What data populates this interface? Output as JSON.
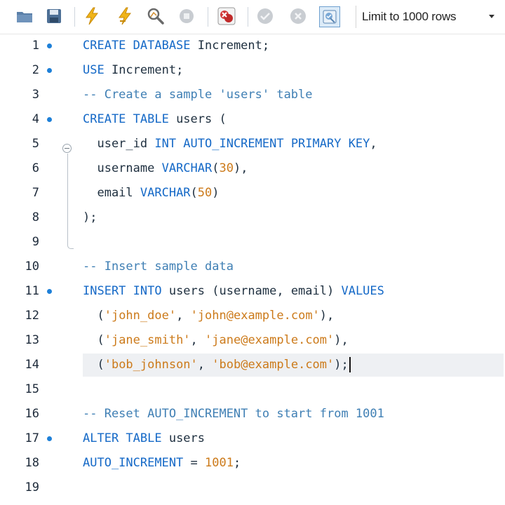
{
  "toolbar": {
    "icons": [
      "open-folder-icon",
      "save-icon",
      "execute-icon",
      "execute-statement-icon",
      "explain-icon",
      "stop-icon",
      "error-toggle-icon",
      "commit-icon",
      "rollback-icon",
      "autocommit-icon"
    ],
    "limit_label": "Limit to 1000 rows"
  },
  "editor": {
    "lines": [
      {
        "num": "1",
        "marker": true,
        "tokens": [
          {
            "t": "CREATE DATABASE",
            "k": "kw"
          },
          {
            "t": " Increment;",
            "k": "plain"
          }
        ]
      },
      {
        "num": "2",
        "marker": true,
        "tokens": [
          {
            "t": "USE",
            "k": "kw"
          },
          {
            "t": " Increment;",
            "k": "plain"
          }
        ]
      },
      {
        "num": "3",
        "marker": false,
        "tokens": [
          {
            "t": "-- Create a sample 'users' table",
            "k": "cm"
          }
        ]
      },
      {
        "num": "4",
        "marker": true,
        "tokens": [
          {
            "t": "CREATE TABLE",
            "k": "kw"
          },
          {
            "t": " users (",
            "k": "plain"
          }
        ]
      },
      {
        "num": "5",
        "marker": false,
        "tokens": [
          {
            "t": "  user_id ",
            "k": "plain"
          },
          {
            "t": "INT AUTO_INCREMENT PRIMARY KEY",
            "k": "kw"
          },
          {
            "t": ",",
            "k": "plain"
          }
        ]
      },
      {
        "num": "6",
        "marker": false,
        "tokens": [
          {
            "t": "  username ",
            "k": "plain"
          },
          {
            "t": "VARCHAR",
            "k": "kw"
          },
          {
            "t": "(",
            "k": "plain"
          },
          {
            "t": "30",
            "k": "num"
          },
          {
            "t": "),",
            "k": "plain"
          }
        ]
      },
      {
        "num": "7",
        "marker": false,
        "tokens": [
          {
            "t": "  email ",
            "k": "plain"
          },
          {
            "t": "VARCHAR",
            "k": "kw"
          },
          {
            "t": "(",
            "k": "plain"
          },
          {
            "t": "50",
            "k": "num"
          },
          {
            "t": ")",
            "k": "plain"
          }
        ]
      },
      {
        "num": "8",
        "marker": false,
        "tokens": [
          {
            "t": ");",
            "k": "plain"
          }
        ]
      },
      {
        "num": "9",
        "marker": false,
        "tokens": []
      },
      {
        "num": "10",
        "marker": false,
        "tokens": [
          {
            "t": "-- Insert sample data",
            "k": "cm"
          }
        ]
      },
      {
        "num": "11",
        "marker": true,
        "tokens": [
          {
            "t": "INSERT INTO",
            "k": "kw"
          },
          {
            "t": " users (username, email) ",
            "k": "plain"
          },
          {
            "t": "VALUES",
            "k": "kw"
          }
        ]
      },
      {
        "num": "12",
        "marker": false,
        "tokens": [
          {
            "t": "  (",
            "k": "plain"
          },
          {
            "t": "'john_doe'",
            "k": "str"
          },
          {
            "t": ", ",
            "k": "plain"
          },
          {
            "t": "'john@example.com'",
            "k": "str"
          },
          {
            "t": "),",
            "k": "plain"
          }
        ]
      },
      {
        "num": "13",
        "marker": false,
        "tokens": [
          {
            "t": "  (",
            "k": "plain"
          },
          {
            "t": "'jane_smith'",
            "k": "str"
          },
          {
            "t": ", ",
            "k": "plain"
          },
          {
            "t": "'jane@example.com'",
            "k": "str"
          },
          {
            "t": "),",
            "k": "plain"
          }
        ]
      },
      {
        "num": "14",
        "marker": false,
        "current": true,
        "tokens": [
          {
            "t": "  (",
            "k": "plain"
          },
          {
            "t": "'bob_johnson'",
            "k": "str"
          },
          {
            "t": ", ",
            "k": "plain"
          },
          {
            "t": "'bob@example.com'",
            "k": "str"
          },
          {
            "t": ");",
            "k": "plain"
          }
        ]
      },
      {
        "num": "15",
        "marker": false,
        "tokens": []
      },
      {
        "num": "16",
        "marker": false,
        "tokens": [
          {
            "t": "-- Reset AUTO_INCREMENT to start from 1001",
            "k": "cm"
          }
        ]
      },
      {
        "num": "17",
        "marker": true,
        "tokens": [
          {
            "t": "ALTER TABLE",
            "k": "kw"
          },
          {
            "t": " users",
            "k": "plain"
          }
        ]
      },
      {
        "num": "18",
        "marker": false,
        "tokens": [
          {
            "t": "AUTO_INCREMENT",
            "k": "kw"
          },
          {
            "t": " = ",
            "k": "plain"
          },
          {
            "t": "1001",
            "k": "num"
          },
          {
            "t": ";",
            "k": "plain"
          }
        ]
      },
      {
        "num": "19",
        "marker": false,
        "tokens": []
      }
    ]
  },
  "colors": {
    "keyword": "#1569c7",
    "comment": "#3f7fb4",
    "string": "#cc7a1a",
    "marker": "#1e80d8"
  }
}
